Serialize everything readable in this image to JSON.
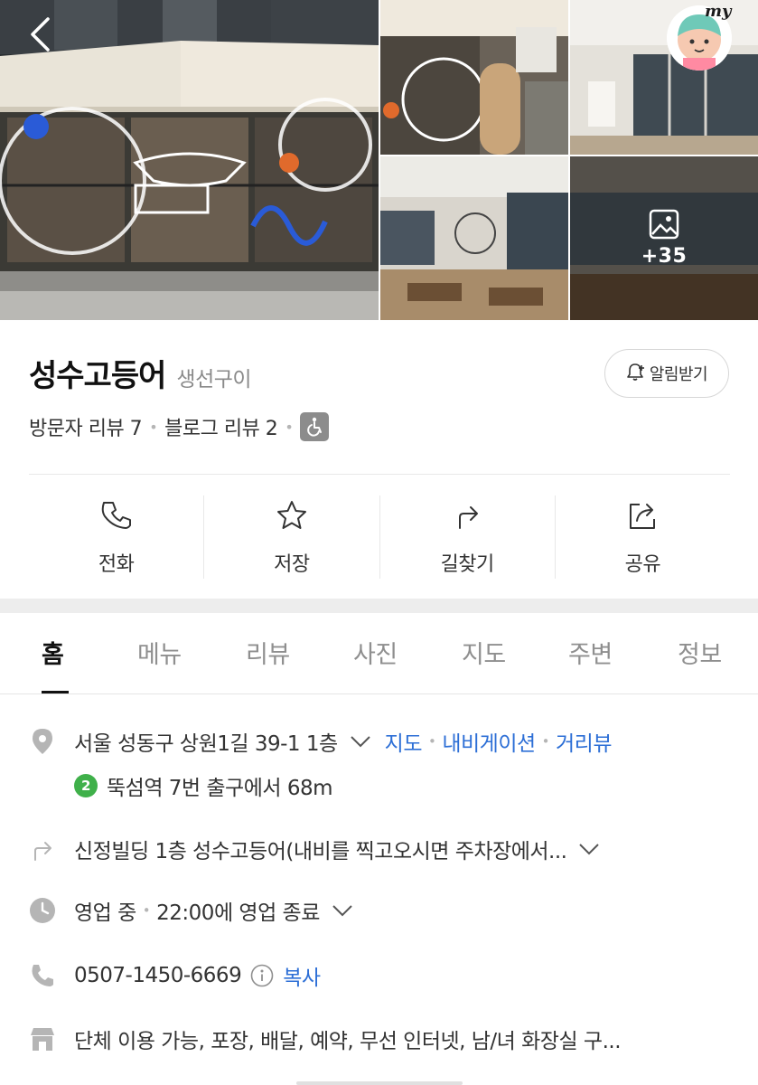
{
  "gallery": {
    "more_photos_count": "+35"
  },
  "header": {
    "my_label": "my"
  },
  "place": {
    "name": "성수고등어",
    "category": "생선구이",
    "notify_label": "알림받기",
    "visitor_reviews": "방문자 리뷰 7",
    "blog_reviews": "블로그 리뷰 2"
  },
  "actions": [
    {
      "label": "전화",
      "icon": "phone-icon"
    },
    {
      "label": "저장",
      "icon": "star-icon"
    },
    {
      "label": "길찾기",
      "icon": "directions-icon"
    },
    {
      "label": "공유",
      "icon": "share-icon"
    }
  ],
  "tabs": [
    {
      "label": "홈",
      "active": true
    },
    {
      "label": "메뉴"
    },
    {
      "label": "리뷰"
    },
    {
      "label": "사진"
    },
    {
      "label": "지도"
    },
    {
      "label": "주변"
    },
    {
      "label": "정보"
    }
  ],
  "info": {
    "address": "서울 성동구 상원1길 39-1 1층",
    "address_links": [
      "지도",
      "내비게이션",
      "거리뷰"
    ],
    "subway_line": "2",
    "subway_text": "뚝섬역 7번 출구에서 68m",
    "directions_note": "신정빌딩 1층 성수고등어(내비를 찍고오시면 주차장에서...",
    "hours_status": "영업 중",
    "hours_text": "22:00에 영업 종료",
    "phone": "0507-1450-6669",
    "copy_label": "복사",
    "amenities": "단체 이용 가능, 포장, 배달, 예약, 무선 인터넷, 남/녀 화장실 구..."
  },
  "colors": {
    "link": "#2d6fd6",
    "subway_line_2": "#3fb04a",
    "muted": "#8f8f8f"
  }
}
